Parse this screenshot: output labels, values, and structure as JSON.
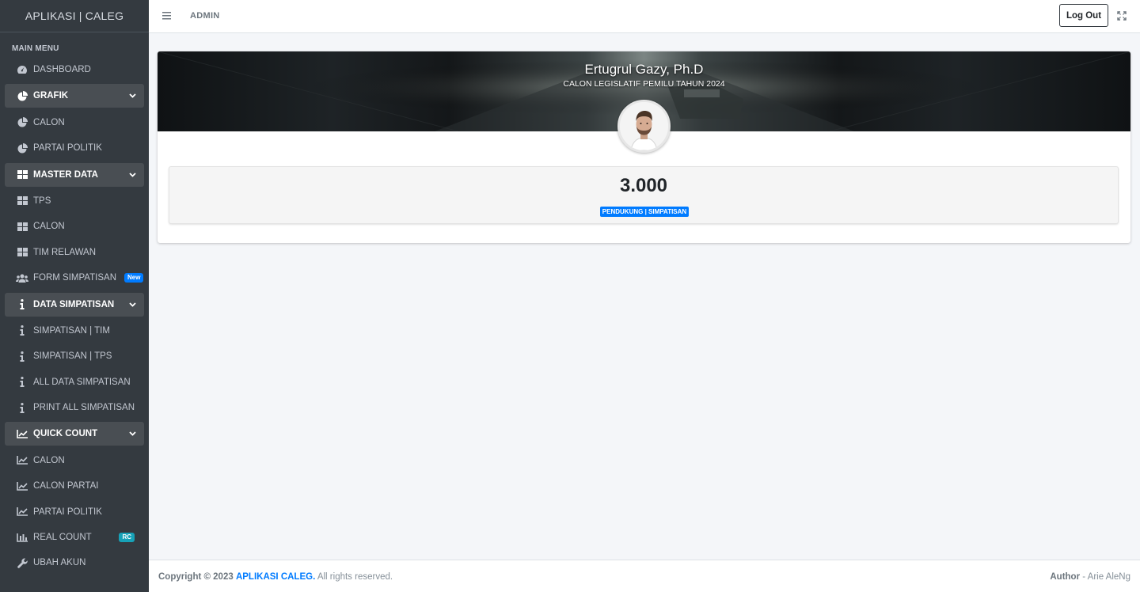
{
  "app": {
    "title": "APLIKASI | CALEG"
  },
  "sidebar": {
    "header": "MAIN MENU",
    "items": [
      {
        "label": "DASHBOARD",
        "icon": "tachometer-icon"
      },
      {
        "label": "GRAFIK",
        "icon": "pie-chart-icon",
        "open": true
      },
      {
        "label": "CALON",
        "icon": "pie-chart-icon"
      },
      {
        "label": "PARTAI POLITIK",
        "icon": "pie-chart-icon"
      },
      {
        "label": "MASTER DATA",
        "icon": "table-icon",
        "open": true
      },
      {
        "label": "TPS",
        "icon": "table-icon"
      },
      {
        "label": "CALON",
        "icon": "table-icon"
      },
      {
        "label": "TIM RELAWAN",
        "icon": "table-icon"
      },
      {
        "label": "FORM SIMPATISAN",
        "icon": "users-icon",
        "badge": "New"
      },
      {
        "label": "DATA SIMPATISAN",
        "icon": "info-icon",
        "open": true
      },
      {
        "label": "SIMPATISAN | TIM",
        "icon": "info-icon"
      },
      {
        "label": "SIMPATISAN | TPS",
        "icon": "info-icon"
      },
      {
        "label": "ALL DATA SIMPATISAN",
        "icon": "info-icon"
      },
      {
        "label": "PRINT ALL SIMPATISAN",
        "icon": "info-icon"
      },
      {
        "label": "QUICK COUNT",
        "icon": "line-chart-icon",
        "open": true
      },
      {
        "label": "CALON",
        "icon": "line-chart-icon"
      },
      {
        "label": "CALON PARTAI",
        "icon": "line-chart-icon"
      },
      {
        "label": "PARTAI POLITIK",
        "icon": "line-chart-icon"
      },
      {
        "label": "REAL COUNT",
        "icon": "bar-chart-icon",
        "badge": "RC"
      },
      {
        "label": "UBAH AKUN",
        "icon": "wrench-icon"
      }
    ]
  },
  "header": {
    "admin_label": "ADMIN",
    "logout_label": "Log Out"
  },
  "profile": {
    "name": "Ertugrul Gazy, Ph.D",
    "subtitle": "CALON LEGISLATIF PEMILU TAHUN 2024",
    "supporters_count": "3.000",
    "supporters_label": "PENDUKUNG | SIMPATISAN"
  },
  "footer": {
    "copyright_prefix": "Copyright © 2023",
    "brand": "APLIKASI CALEG.",
    "rights": "All rights reserved.",
    "author_label": "Author",
    "author_name": "- Arie AleNg"
  },
  "colors": {
    "sidebar_bg": "#343a40",
    "primary": "#007bff",
    "info": "#17a2b8"
  }
}
